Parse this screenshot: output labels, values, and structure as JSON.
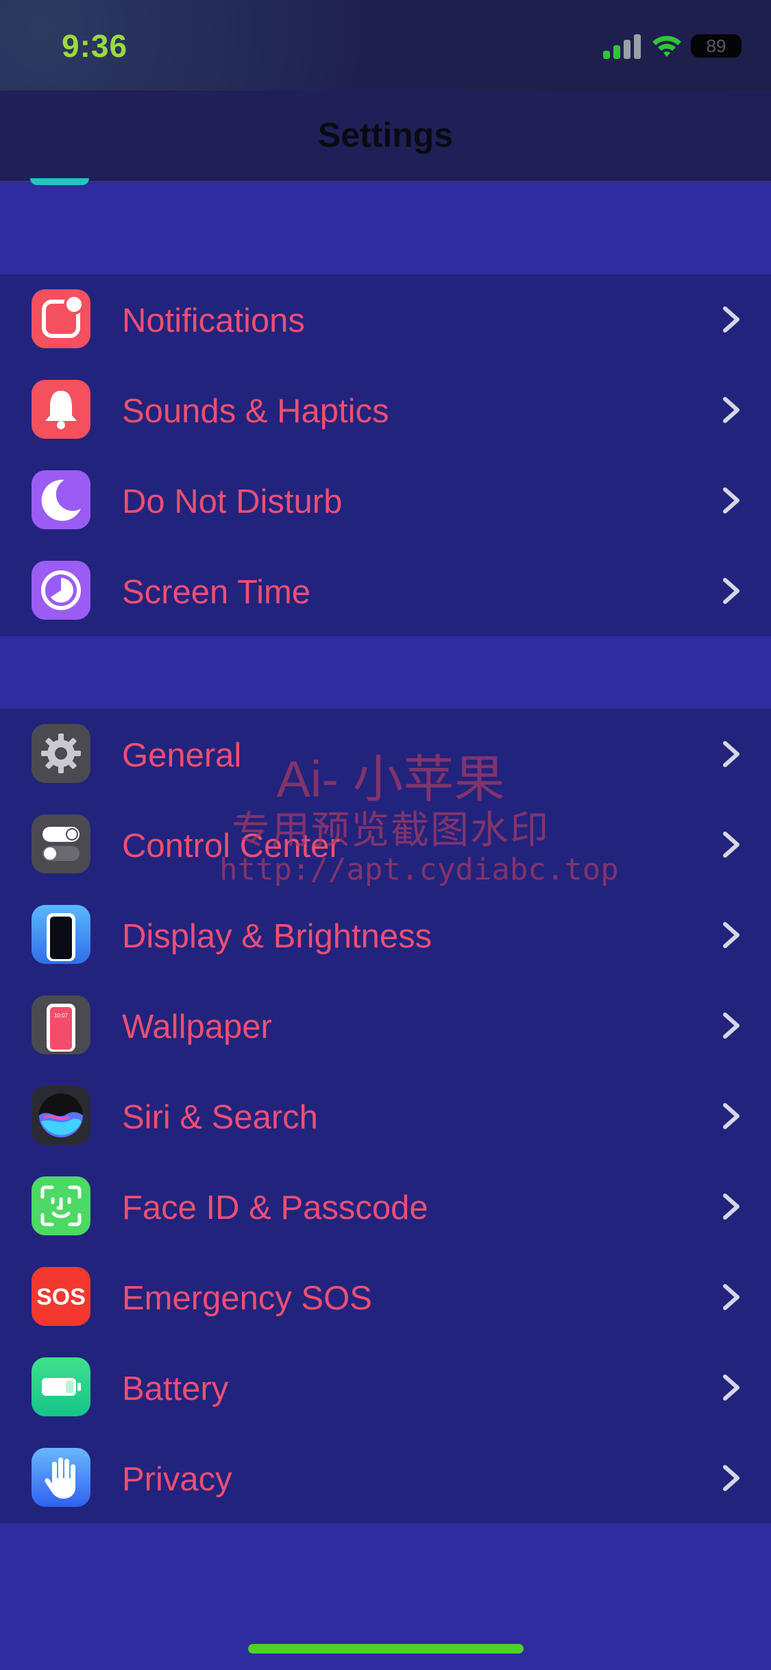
{
  "status_bar": {
    "time": "9:36",
    "battery": "89"
  },
  "nav": {
    "title": "Settings"
  },
  "sections": [
    [
      {
        "label": "Notifications",
        "icon": "notifications-icon"
      },
      {
        "label": "Sounds & Haptics",
        "icon": "sounds-icon"
      },
      {
        "label": "Do Not Disturb",
        "icon": "moon-icon"
      },
      {
        "label": "Screen Time",
        "icon": "screen-time-icon"
      }
    ],
    [
      {
        "label": "General",
        "icon": "gear-icon"
      },
      {
        "label": "Control Center",
        "icon": "control-center-icon"
      },
      {
        "label": "Display & Brightness",
        "icon": "display-icon"
      },
      {
        "label": "Wallpaper",
        "icon": "wallpaper-icon"
      },
      {
        "label": "Siri & Search",
        "icon": "siri-icon"
      },
      {
        "label": "Face ID & Passcode",
        "icon": "face-id-icon"
      },
      {
        "label": "Emergency SOS",
        "icon": "sos-icon"
      },
      {
        "label": "Battery",
        "icon": "battery-icon"
      },
      {
        "label": "Privacy",
        "icon": "hand-icon"
      }
    ]
  ],
  "icons": {
    "sos_text": "SOS",
    "wallpaper_clock": "10:07"
  },
  "watermark": {
    "line1": "Ai- 小苹果",
    "line2": "专用预览截图水印",
    "line3": "http://apt.cydiabc.top"
  },
  "colors": {
    "background": "#2e2c9e",
    "cell": "#22237d",
    "label": "#ee4f72",
    "chevron": "#d6d6e6",
    "time": "#9adb3e",
    "home_indicator": "#4cd227"
  }
}
